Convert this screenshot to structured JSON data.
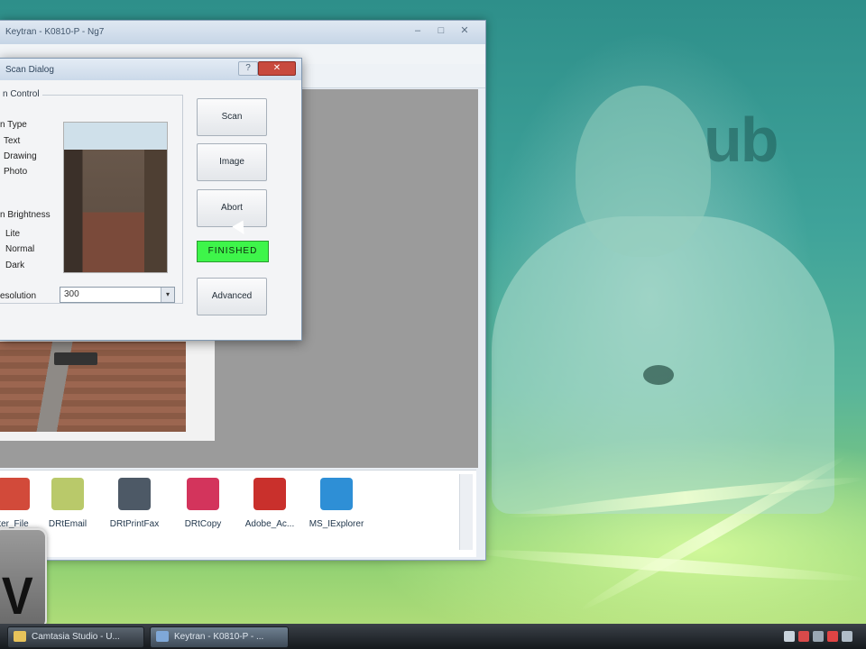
{
  "main_window": {
    "title": "Keytran - K0810-P - Ng7",
    "controls": [
      "–",
      "□",
      "✕"
    ]
  },
  "scan_dialog": {
    "title": "Scan Dialog",
    "help_label": "?",
    "close_label": "✕",
    "group_label": "n Control",
    "type_label": "n Type",
    "type_options": [
      "Text",
      "Drawing",
      "Photo"
    ],
    "brightness_label": "n Brightness",
    "brightness_options": [
      "Lite",
      "Normal",
      "Dark"
    ],
    "resolution_label": "esolution",
    "resolution_value": "300",
    "resolution_arrow": "▾",
    "buttons": {
      "scan": "Scan",
      "image": "Image",
      "abort": "Abort",
      "advanced": "Advanced"
    },
    "status": "FINISHED"
  },
  "shortcuts": [
    {
      "label": "ter_File",
      "color": "#d24a3a"
    },
    {
      "label": "DRtEmail",
      "color": "#b9c96a"
    },
    {
      "label": "DRtPrintFax",
      "color": "#4d5966"
    },
    {
      "label": "DRtCopy",
      "color": "#d3345c"
    },
    {
      "label": "Adobe_Ac...",
      "color": "#c9302c"
    },
    {
      "label": "MS_IExplorer",
      "color": "#2e8fd6"
    }
  ],
  "watermark": {
    "letter": "V"
  },
  "taskbar": {
    "items": [
      {
        "label": "Camtasia Studio - U...",
        "active": false
      },
      {
        "label": "Keytran - K0810-P - ...",
        "active": true
      }
    ]
  },
  "colors": {
    "status_green": "#3ef54a",
    "close_red": "#c84a3e",
    "desktop_teal": "#3fa39a"
  }
}
